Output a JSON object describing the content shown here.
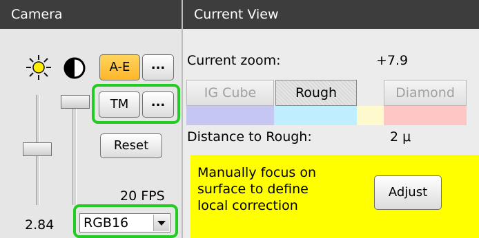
{
  "camera": {
    "header": "Camera",
    "ae_button": "A-E",
    "ae_more": "...",
    "tm_button": "TM",
    "tm_more": "...",
    "reset_button": "Reset",
    "fps": "20 FPS",
    "value": "2.84",
    "format_select": "RGB16",
    "colors": {
      "ae_bg": "#ffc43d",
      "highlight": "#22cc22"
    }
  },
  "view": {
    "header": "Current View",
    "zoom_label": "Current zoom:",
    "zoom_value": "+7.9",
    "tabs": [
      {
        "label": "IG Cube",
        "state": "disabled",
        "color": "#c6c6f3"
      },
      {
        "label": "Rough",
        "state": "selected",
        "color": "#bfefff"
      },
      {
        "label": "Diamond",
        "state": "disabled",
        "color": "#ffc6c6"
      }
    ],
    "spacer_color": "#fffacd",
    "distance_label": "Distance to Rough:",
    "distance_value": "2 μ",
    "focus_message": "Manually focus on\nsurface to define\nlocal correction",
    "focus_bg": "#ffff00",
    "adjust_button": "Adjust"
  },
  "icons": {
    "brightness": "sun-icon",
    "contrast": "contrast-icon",
    "dropdown": "chevron-down-icon"
  }
}
